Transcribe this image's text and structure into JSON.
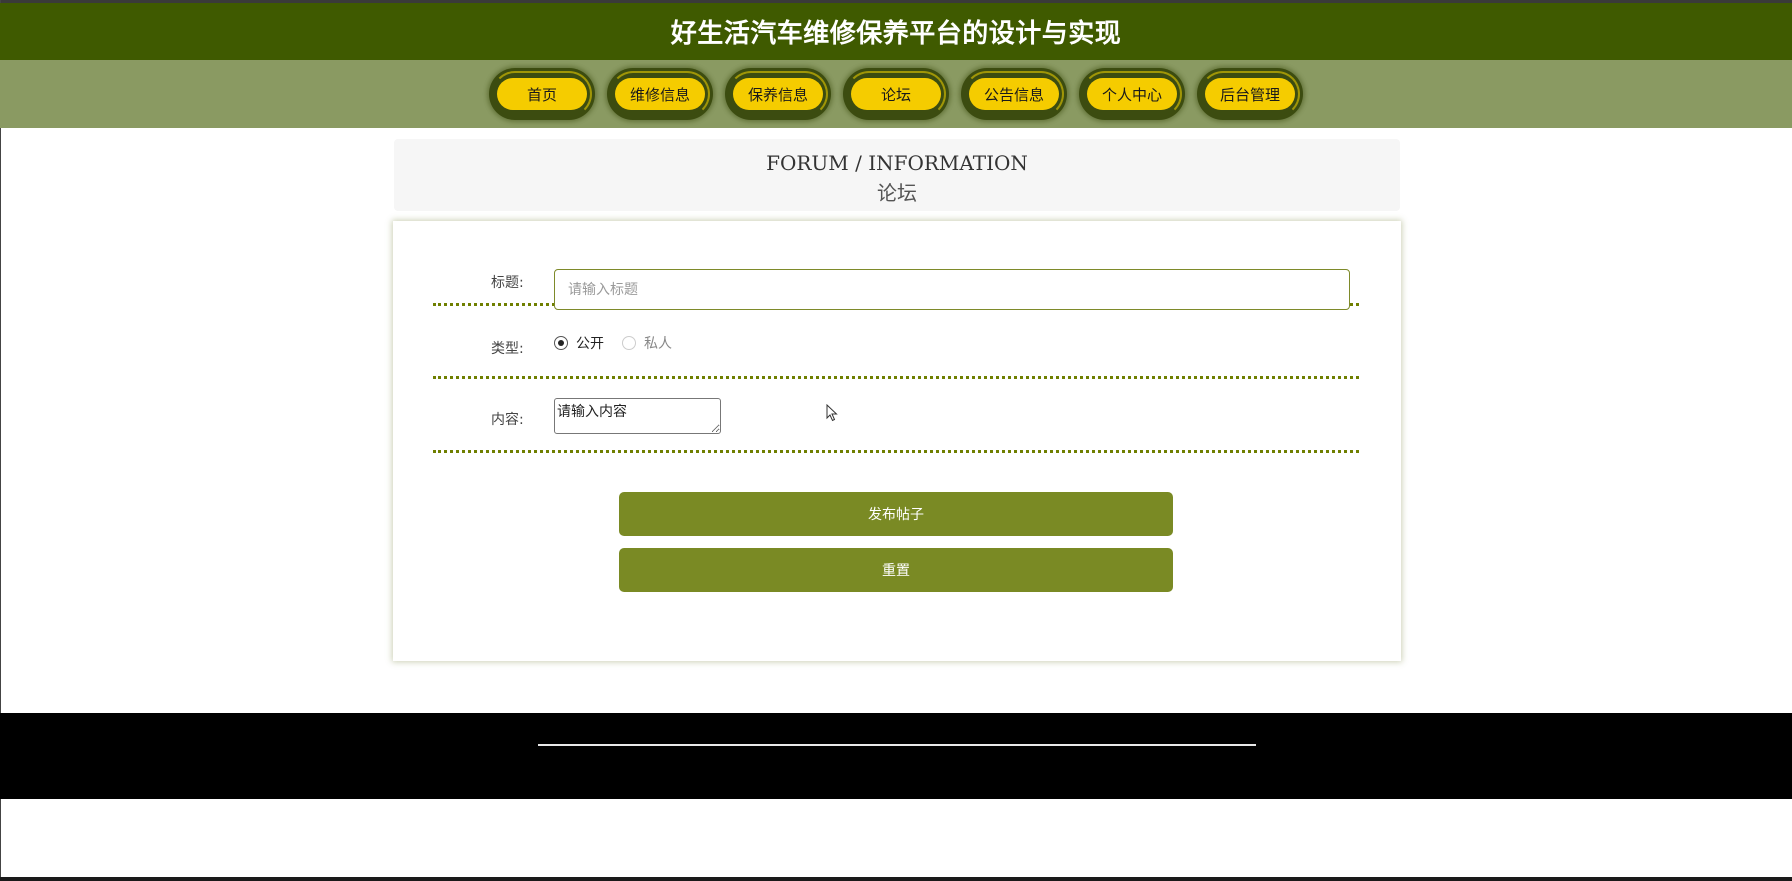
{
  "header": {
    "title": "好生活汽车维修保养平台的设计与实现"
  },
  "nav": {
    "items": [
      {
        "label": "首页"
      },
      {
        "label": "维修信息"
      },
      {
        "label": "保养信息"
      },
      {
        "label": "论坛"
      },
      {
        "label": "公告信息"
      },
      {
        "label": "个人中心"
      },
      {
        "label": "后台管理"
      }
    ]
  },
  "section": {
    "title_en": "FORUM / INFORMATION",
    "title_cn": "论坛"
  },
  "form": {
    "title": {
      "label": "标题:",
      "placeholder": "请输入标题",
      "value": ""
    },
    "type": {
      "label": "类型:",
      "options": [
        {
          "label": "公开",
          "checked": true
        },
        {
          "label": "私人",
          "checked": false
        }
      ]
    },
    "content": {
      "label": "内容:",
      "placeholder": "请输入内容",
      "value": ""
    },
    "submit_label": "发布帖子",
    "reset_label": "重置"
  },
  "colors": {
    "header_bg": "#3f5a00",
    "nav_bg": "#8a9a62",
    "nav_pill": "#f5cc00",
    "button_bg": "#7a8a24",
    "footer_bg": "#000000"
  },
  "icons": {
    "cursor": "mouse-pointer-icon"
  }
}
